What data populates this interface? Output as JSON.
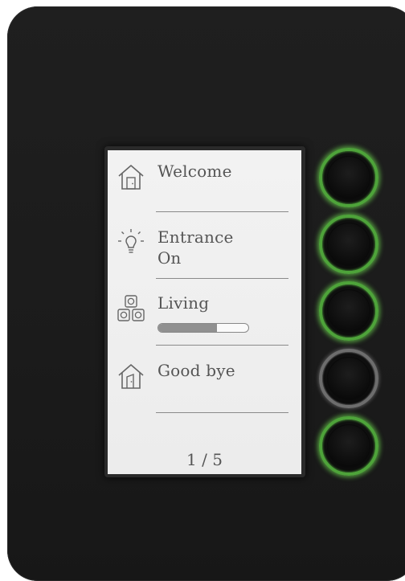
{
  "screen": {
    "items": [
      {
        "icon": "house-door-icon",
        "label": "Welcome",
        "sub": ""
      },
      {
        "icon": "lightbulb-icon",
        "label": "Entrance",
        "sub": "On"
      },
      {
        "icon": "speakers-icon",
        "label": "Living",
        "sub": "",
        "level": 0.65
      },
      {
        "icon": "house-exit-icon",
        "label": "Good bye",
        "sub": ""
      }
    ],
    "page": "1 / 5"
  },
  "buttons": [
    {
      "state": "active",
      "ring_color": "#4ea33a"
    },
    {
      "state": "active",
      "ring_color": "#4ea33a"
    },
    {
      "state": "active",
      "ring_color": "#4ea33a"
    },
    {
      "state": "inactive",
      "ring_color": "#6d6d6d"
    },
    {
      "state": "active",
      "ring_color": "#4ea33a"
    }
  ],
  "colors": {
    "panel": "#1c1c1c",
    "screen": "#efefef",
    "text": "#555555"
  }
}
